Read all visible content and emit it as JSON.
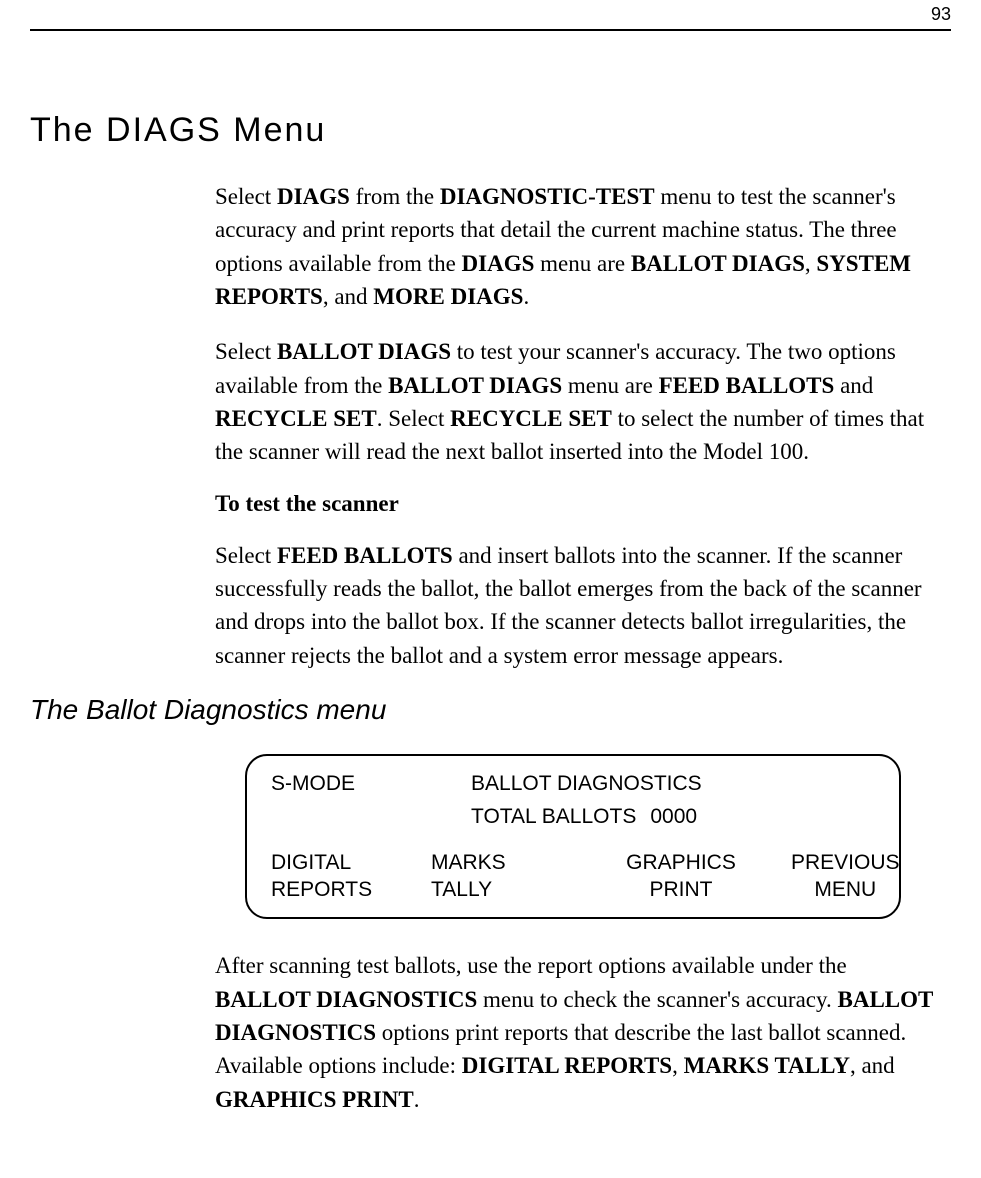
{
  "page_number": "93",
  "heading1": "The DIAGS Menu",
  "para1": {
    "t1": "Select ",
    "b1": "DIAGS",
    "t2": " from the ",
    "b2": "DIAGNOSTIC-TEST",
    "t3": " menu to test the scanner's accuracy and print reports that detail the current machine status. The three options available from the ",
    "b3": "DIAGS",
    "t4": " menu are ",
    "b4": "BALLOT DIAGS",
    "t5": ", ",
    "b5": "SYSTEM REPORTS",
    "t6": ", and ",
    "b6": "MORE DIAGS",
    "t7": "."
  },
  "para2": {
    "t1": "Select ",
    "b1": "BALLOT DIAGS",
    "t2": " to test your scanner's accuracy. The two options available from the ",
    "b2": "BALLOT DIAGS",
    "t3": " menu are ",
    "b3": "FEED BALLOTS",
    "t4": " and ",
    "b4": "RECYCLE SET",
    "t5": ". Select ",
    "b5": "RECYCLE SET",
    "t6": " to select the number of times that the scanner will read the next ballot inserted into the Model 100."
  },
  "subheading": "To test the scanner",
  "para3": {
    "t1": "Select ",
    "b1": "FEED BALLOTS",
    "t2": " and insert ballots into the scanner. If the scanner successfully reads the ballot, the ballot emerges from the back of the scanner and drops into the ballot box. If the scanner detects ballot irregularities, the scanner rejects the ballot and a system error message appears."
  },
  "heading2": "The Ballot Diagnostics menu",
  "screen": {
    "mode": "S-MODE",
    "title": "BALLOT DIAGNOSTICS",
    "total_label": "TOTAL BALLOTS",
    "total_value": "0000",
    "options": [
      {
        "line1": "DIGITAL",
        "line2": "REPORTS"
      },
      {
        "line1": "MARKS",
        "line2": "TALLY"
      },
      {
        "line1": "GRAPHICS",
        "line2": "PRINT"
      },
      {
        "line1": "PREVIOUS",
        "line2": "MENU"
      }
    ]
  },
  "para4": {
    "t1": "After scanning test ballots, use the report options available under the ",
    "b1": "BALLOT DIAGNOSTICS",
    "t2": " menu to check the scanner's accuracy. ",
    "b2": "BALLOT DIAGNOSTICS",
    "t3": " options print reports that describe the last ballot scanned. Available options include: ",
    "b3": "DIGITAL REPORTS",
    "t4": ", ",
    "b4": "MARKS TALLY",
    "t5": ", and ",
    "b5": "GRAPHICS PRINT",
    "t6": "."
  }
}
